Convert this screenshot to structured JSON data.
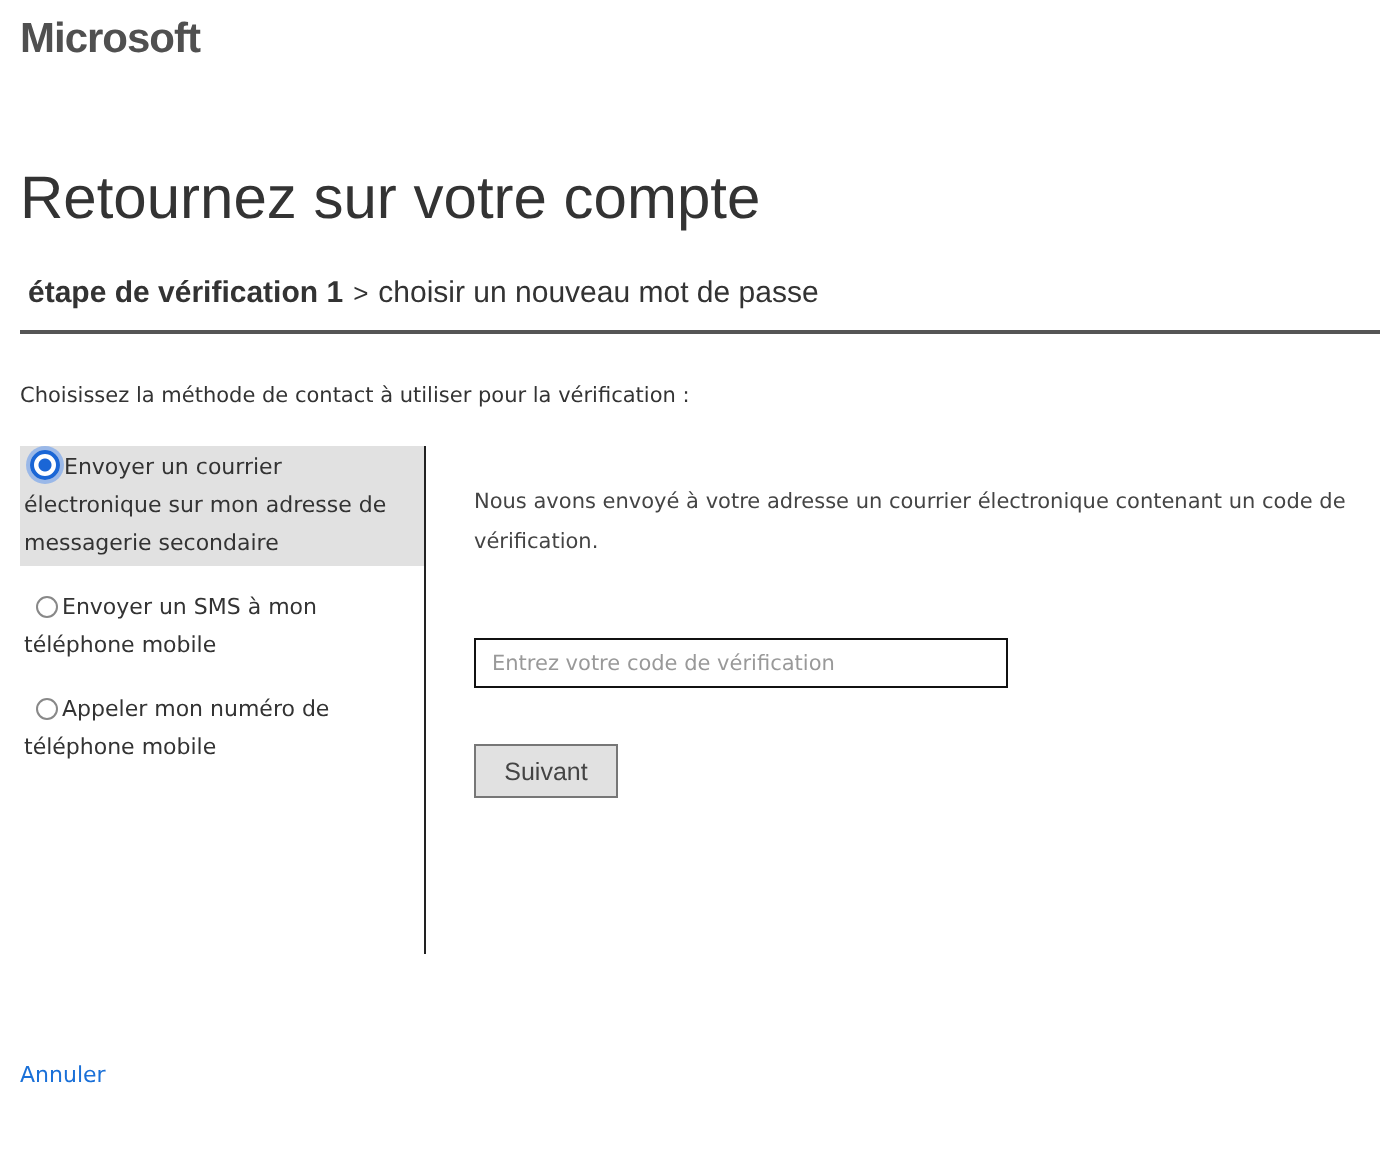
{
  "logo": "Microsoft",
  "title": "Retournez sur votre compte",
  "breadcrumb": {
    "current": "étape de vérification 1",
    "separator": ">",
    "next": "choisir un nouveau mot de passe"
  },
  "prompt": "Choisissez la méthode de contact à utiliser pour la vérification :",
  "options": [
    {
      "label": "Envoyer un courrier électronique sur mon adresse de messagerie secondaire",
      "selected": true
    },
    {
      "label": "Envoyer un SMS à mon téléphone mobile",
      "selected": false
    },
    {
      "label": "Appeler mon numéro de téléphone mobile",
      "selected": false
    }
  ],
  "message": "Nous avons envoyé à votre adresse un courrier électronique contenant un code de vérification.",
  "code_field": {
    "placeholder": "Entrez votre code de vérification"
  },
  "next_button": "Suivant",
  "cancel_link": "Annuler"
}
